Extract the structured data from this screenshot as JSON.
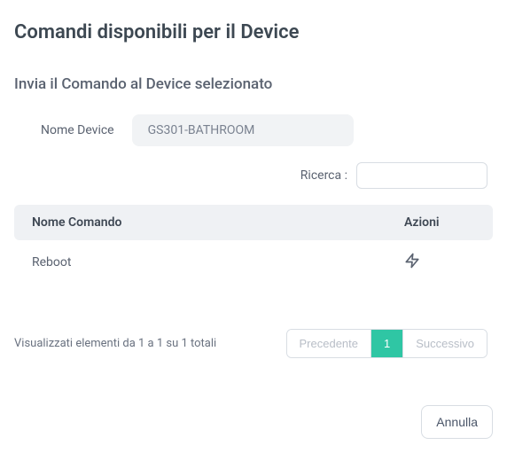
{
  "header": {
    "title": "Comandi disponibili per il Device"
  },
  "section": {
    "subtitle": "Invia il Comando al Device selezionato",
    "deviceLabel": "Nome Device",
    "deviceName": "GS301-BATHROOM"
  },
  "search": {
    "label": "Ricerca :",
    "value": ""
  },
  "table": {
    "headers": {
      "name": "Nome Comando",
      "actions": "Azioni"
    },
    "rows": [
      {
        "name": "Reboot",
        "actionIcon": "lightning-icon"
      }
    ]
  },
  "pagination": {
    "resultsText": "Visualizzati elementi da 1 a 1 su 1 totali",
    "prevLabel": "Precedente",
    "nextLabel": "Successivo",
    "currentPage": "1"
  },
  "buttons": {
    "cancel": "Annulla"
  }
}
